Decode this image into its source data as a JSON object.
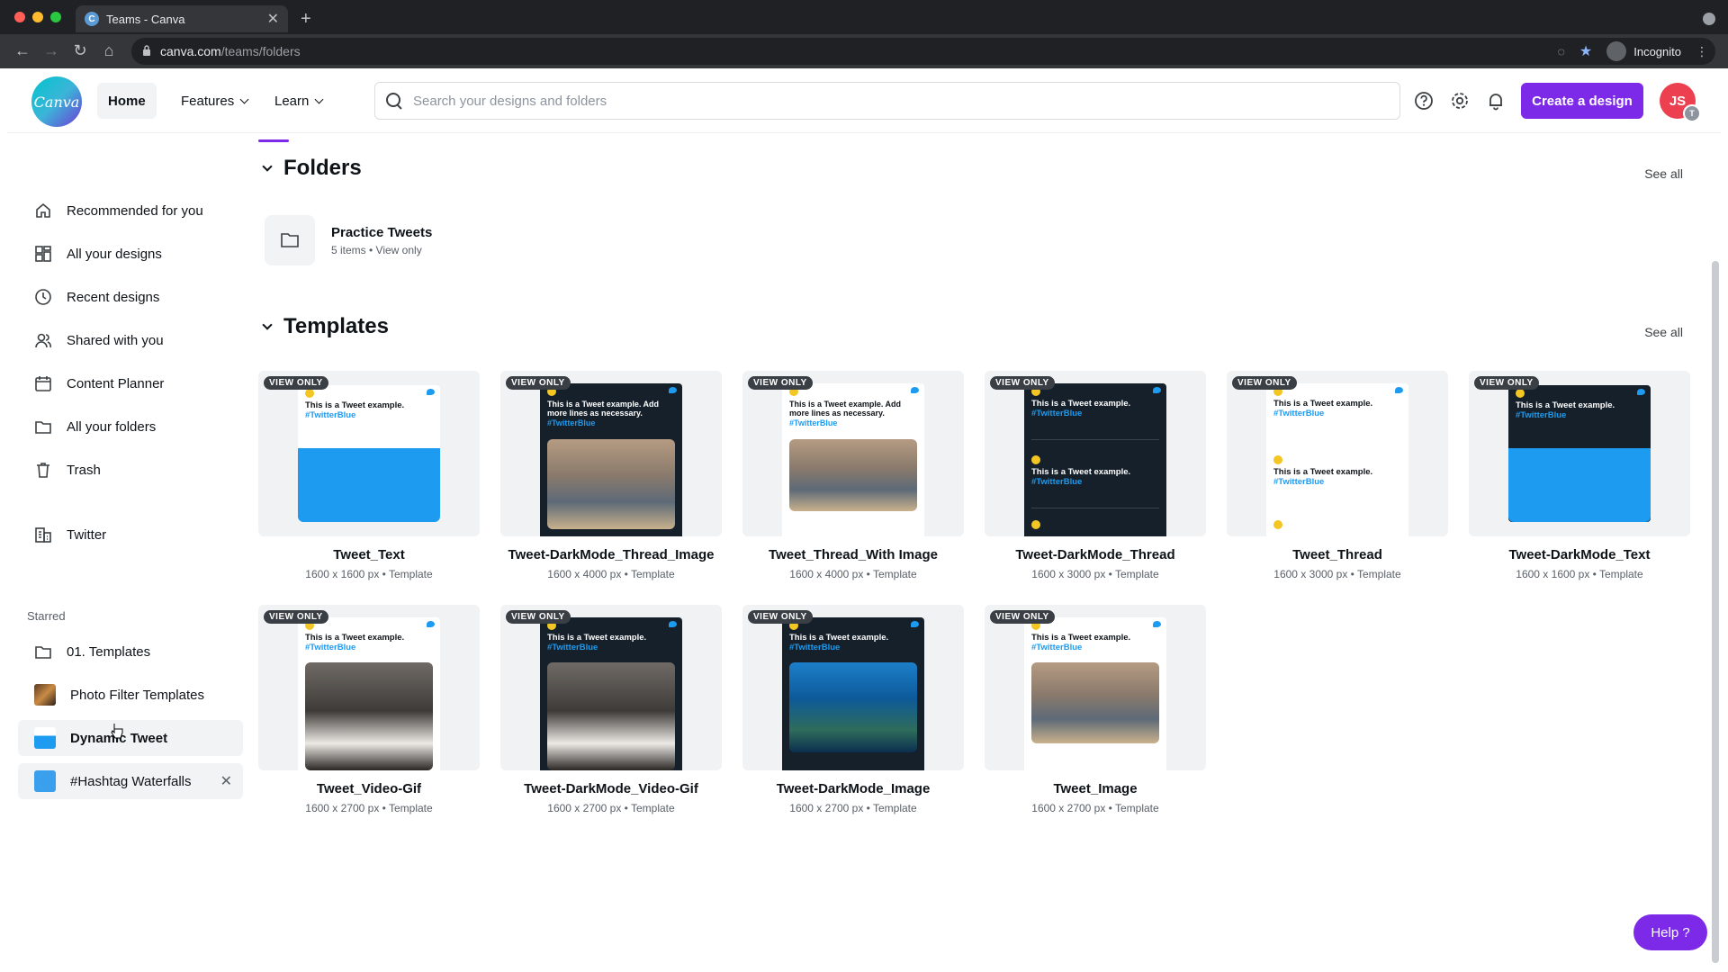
{
  "browser": {
    "tab_title": "Teams - Canva",
    "url_host": "canva.com",
    "url_path": "/teams/folders",
    "profile_label": "Incognito"
  },
  "header": {
    "logo_text": "Canva",
    "nav": [
      "Home",
      "Features",
      "Learn"
    ],
    "search_placeholder": "Search your designs and folders",
    "create_button": "Create a design",
    "avatar_initials": "JS",
    "avatar_badge": "T"
  },
  "sidebar": {
    "items": [
      {
        "label": "Recommended for you",
        "icon": "home-icon"
      },
      {
        "label": "All your designs",
        "icon": "grid-icon"
      },
      {
        "label": "Recent designs",
        "icon": "clock-icon"
      },
      {
        "label": "Shared with you",
        "icon": "people-icon"
      },
      {
        "label": "Content Planner",
        "icon": "calendar-icon"
      },
      {
        "label": "All your folders",
        "icon": "folder-icon"
      },
      {
        "label": "Trash",
        "icon": "trash-icon"
      }
    ],
    "team": {
      "label": "Twitter",
      "icon": "team-icon"
    },
    "starred_heading": "Starred",
    "starred": [
      {
        "label": "01. Templates",
        "icon": "folder-icon"
      },
      {
        "label": "Photo Filter Templates",
        "icon": "image-thumb"
      },
      {
        "label": "Dynamic Tweet",
        "icon": "image-thumb"
      },
      {
        "label": "#Hashtag Waterfalls",
        "icon": "image-thumb"
      }
    ]
  },
  "folders": {
    "title": "Folders",
    "see_all": "See all",
    "items": [
      {
        "name": "Practice Tweets",
        "meta": "5 items • View only"
      }
    ]
  },
  "templates": {
    "title": "Templates",
    "see_all": "See all",
    "badge": "VIEW ONLY",
    "tweet_text": "This is a Tweet example.",
    "tweet_text_long": "This is a Tweet example. Add more lines as necessary.",
    "hashtag": "#TwitterBlue",
    "items": [
      {
        "name": "Tweet_Text",
        "meta": "1600 x 1600 px • Template"
      },
      {
        "name": "Tweet-DarkMode_Thread_Image",
        "meta": "1600 x 4000 px • Template"
      },
      {
        "name": "Tweet_Thread_With Image",
        "meta": "1600 x 4000 px • Template"
      },
      {
        "name": "Tweet-DarkMode_Thread",
        "meta": "1600 x 3000 px • Template"
      },
      {
        "name": "Tweet_Thread",
        "meta": "1600 x 3000 px • Template"
      },
      {
        "name": "Tweet-DarkMode_Text",
        "meta": "1600 x 1600 px • Template"
      },
      {
        "name": "Tweet_Video-Gif",
        "meta": "1600 x 2700 px • Template"
      },
      {
        "name": "Tweet-DarkMode_Video-Gif",
        "meta": "1600 x 2700 px • Template"
      },
      {
        "name": "Tweet-DarkMode_Image",
        "meta": "1600 x 2700 px • Template"
      },
      {
        "name": "Tweet_Image",
        "meta": "1600 x 2700 px • Template"
      }
    ]
  },
  "help_button": "Help ?",
  "colors": {
    "accent": "#7d2ae8",
    "twitter_blue": "#1d9bf0",
    "dark_tweet": "#15202b"
  }
}
